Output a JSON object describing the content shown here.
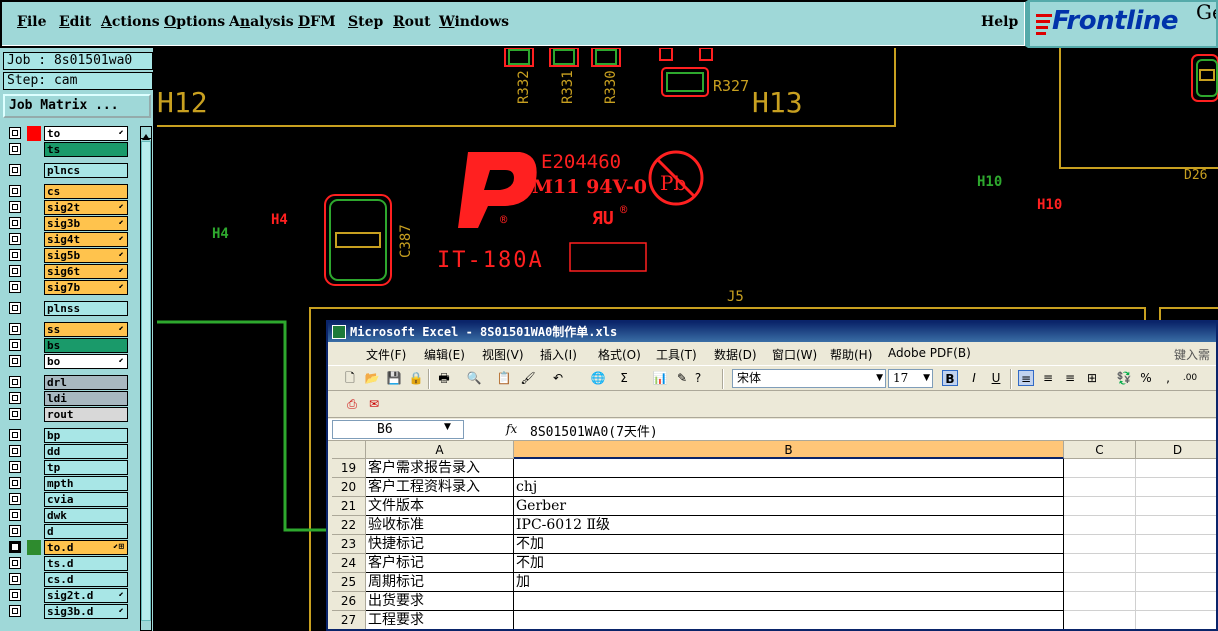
{
  "menubar": {
    "items": [
      {
        "label": "File",
        "ul": "F"
      },
      {
        "label": "Edit",
        "ul": "E"
      },
      {
        "label": "Actions",
        "ul": "A"
      },
      {
        "label": "Options",
        "ul": "O"
      },
      {
        "label": "Analysis",
        "ul": "n"
      },
      {
        "label": "DFM",
        "ul": "D"
      },
      {
        "label": "Step",
        "ul": "S"
      },
      {
        "label": "Rout",
        "ul": "R"
      },
      {
        "label": "Windows",
        "ul": "W"
      }
    ],
    "help": "Help",
    "logo": "Frontline",
    "logo_suffix": "Ge"
  },
  "leftpanel": {
    "job": "Job : 8s01501wa0",
    "step": "Step: cam",
    "job_matrix_button": "Job Matrix ...",
    "layers": [
      {
        "name": "to",
        "color": "#ffffff",
        "swatch": "#ff0000",
        "flag": "⬋"
      },
      {
        "name": "ts",
        "color": "#1a9a6a",
        "swatch": null,
        "flag": ""
      },
      {
        "name": "plncs",
        "color": "#a8e6e6",
        "swatch": null,
        "flag": ""
      },
      {
        "name": "cs",
        "color": "#ffc34d",
        "swatch": null,
        "flag": ""
      },
      {
        "name": "sig2t",
        "color": "#ffc34d",
        "swatch": null,
        "flag": "⬋"
      },
      {
        "name": "sig3b",
        "color": "#ffc34d",
        "swatch": null,
        "flag": "⬋"
      },
      {
        "name": "sig4t",
        "color": "#ffc34d",
        "swatch": null,
        "flag": "⬋"
      },
      {
        "name": "sig5b",
        "color": "#ffc34d",
        "swatch": null,
        "flag": "⬋"
      },
      {
        "name": "sig6t",
        "color": "#ffc34d",
        "swatch": null,
        "flag": "⬋"
      },
      {
        "name": "sig7b",
        "color": "#ffc34d",
        "swatch": null,
        "flag": "⬋"
      },
      {
        "name": "plnss",
        "color": "#a8e6e6",
        "swatch": null,
        "flag": ""
      },
      {
        "name": "ss",
        "color": "#ffc34d",
        "swatch": null,
        "flag": "⬋"
      },
      {
        "name": "bs",
        "color": "#1a9a6a",
        "swatch": null,
        "flag": ""
      },
      {
        "name": "bo",
        "color": "#ffffff",
        "swatch": null,
        "flag": "⬋"
      },
      {
        "name": "drl",
        "color": "#a8b8c0",
        "swatch": null,
        "flag": ""
      },
      {
        "name": "ldi",
        "color": "#a8b8c0",
        "swatch": null,
        "flag": ""
      },
      {
        "name": "rout",
        "color": "#d8d8d8",
        "swatch": null,
        "flag": ""
      },
      {
        "name": "bp",
        "color": "#a8e6e6",
        "swatch": null,
        "flag": ""
      },
      {
        "name": "dd",
        "color": "#a8e6e6",
        "swatch": null,
        "flag": ""
      },
      {
        "name": "tp",
        "color": "#a8e6e6",
        "swatch": null,
        "flag": ""
      },
      {
        "name": "mpth",
        "color": "#a8e6e6",
        "swatch": null,
        "flag": ""
      },
      {
        "name": "cvia",
        "color": "#a8e6e6",
        "swatch": null,
        "flag": ""
      },
      {
        "name": "dwk",
        "color": "#a8e6e6",
        "swatch": null,
        "flag": ""
      },
      {
        "name": "d",
        "color": "#a8e6e6",
        "swatch": null,
        "flag": ""
      },
      {
        "name": "to.d",
        "color": "#ffc34d",
        "swatch": "#2e8b2e",
        "flag": "⬋⊞",
        "selected": true
      },
      {
        "name": "ts.d",
        "color": "#a8e6e6",
        "swatch": null,
        "flag": ""
      },
      {
        "name": "cs.d",
        "color": "#a8e6e6",
        "swatch": null,
        "flag": ""
      },
      {
        "name": "sig2t.d",
        "color": "#a8e6e6",
        "swatch": null,
        "flag": "⬋"
      },
      {
        "name": "sig3b.d",
        "color": "#a8e6e6",
        "swatch": null,
        "flag": "⬋"
      }
    ]
  },
  "pcb": {
    "labels": {
      "h12": "H12",
      "h13": "H13",
      "h4_green": "H4",
      "h4_red": "H4",
      "h10_green": "H10",
      "h10_red": "H10",
      "j5": "J5",
      "c387": "C387",
      "r332": "R332",
      "r331": "R331",
      "r330": "R330",
      "r327": "R327",
      "d26": "D26",
      "e204460": "E204460",
      "m11": "M11 94V-0",
      "pb": "Pb",
      "it180a": "IT-180A",
      "r_mark": "®",
      "ru_mark": "ЯU"
    }
  },
  "excel": {
    "title": "Microsoft Excel - 8S01501WA0制作单.xls",
    "menu": [
      "文件(F)",
      "编辑(E)",
      "视图(V)",
      "插入(I)",
      "格式(O)",
      "工具(T)",
      "数据(D)",
      "窗口(W)",
      "帮助(H)",
      "Adobe PDF(B)"
    ],
    "help_input": "键入需要",
    "font": "宋体",
    "font_size": "17",
    "name_box": "B6",
    "fx": "fx",
    "formula": "8S01501WA0(7天件)",
    "columns": [
      "A",
      "B",
      "C",
      "D"
    ],
    "rows": [
      {
        "num": "19",
        "a": "客户需求报告录入",
        "b": ""
      },
      {
        "num": "20",
        "a": "客户工程资料录入",
        "b": "chj"
      },
      {
        "num": "21",
        "a": "文件版本",
        "b": "Gerber"
      },
      {
        "num": "22",
        "a": "验收标准",
        "b": "IPC-6012 Ⅱ级"
      },
      {
        "num": "23",
        "a": "快捷标记",
        "b": "不加"
      },
      {
        "num": "24",
        "a": "客户标记",
        "b": "不加"
      },
      {
        "num": "25",
        "a": "周期标记",
        "b": "加"
      },
      {
        "num": "26",
        "a": "出货要求",
        "b": ""
      },
      {
        "num": "27",
        "a": "工程要求",
        "b": ""
      }
    ]
  }
}
